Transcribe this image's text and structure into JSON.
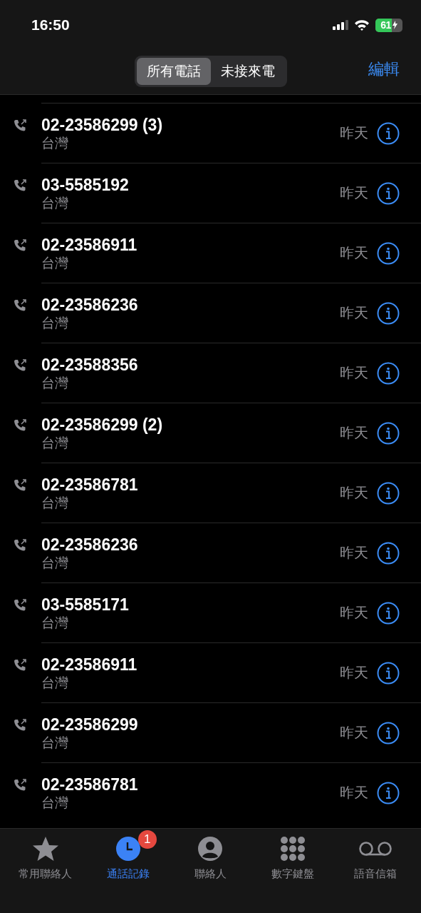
{
  "status_bar": {
    "time": "16:50",
    "battery": "61"
  },
  "segments": [
    {
      "label": "所有電話",
      "selected": true
    },
    {
      "label": "未接來電",
      "selected": false
    }
  ],
  "edit": "編輯",
  "calls": [
    {
      "number": "02-23586299 (3)",
      "location": "台灣",
      "date": "昨天"
    },
    {
      "number": "03-5585192",
      "location": "台灣",
      "date": "昨天"
    },
    {
      "number": "02-23586911",
      "location": "台灣",
      "date": "昨天"
    },
    {
      "number": "02-23586236",
      "location": "台灣",
      "date": "昨天"
    },
    {
      "number": "02-23588356",
      "location": "台灣",
      "date": "昨天"
    },
    {
      "number": "02-23586299 (2)",
      "location": "台灣",
      "date": "昨天"
    },
    {
      "number": "02-23586781",
      "location": "台灣",
      "date": "昨天"
    },
    {
      "number": "02-23586236",
      "location": "台灣",
      "date": "昨天"
    },
    {
      "number": "03-5585171",
      "location": "台灣",
      "date": "昨天"
    },
    {
      "number": "02-23586911",
      "location": "台灣",
      "date": "昨天"
    },
    {
      "number": "02-23586299",
      "location": "台灣",
      "date": "昨天"
    },
    {
      "number": "02-23586781",
      "location": "台灣",
      "date": "昨天"
    }
  ],
  "tab_bar": [
    {
      "kind": "star",
      "label": "常用聯絡人",
      "selected": false
    },
    {
      "kind": "clock",
      "label": "通話記錄",
      "selected": true,
      "badge": "1"
    },
    {
      "kind": "person",
      "label": "聯絡人",
      "selected": false
    },
    {
      "kind": "keypad",
      "label": "數字鍵盤",
      "selected": false
    },
    {
      "kind": "voicemail",
      "label": "語音信箱",
      "selected": false
    }
  ]
}
